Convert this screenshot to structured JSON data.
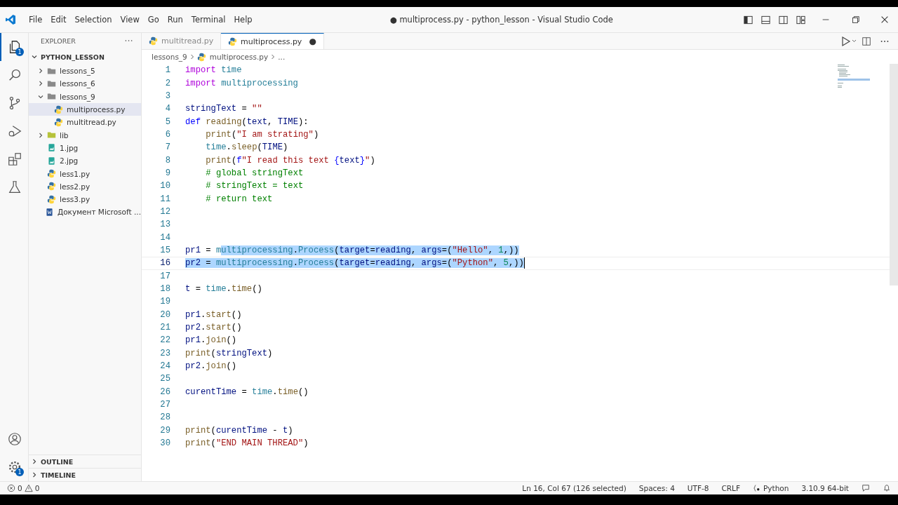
{
  "window": {
    "title": "● multiprocess.py - python_lesson - Visual Studio Code"
  },
  "menu": [
    "File",
    "Edit",
    "Selection",
    "View",
    "Go",
    "Run",
    "Terminal",
    "Help"
  ],
  "activity_bar": [
    {
      "kind": "explorer",
      "selected": true,
      "badge": "1"
    },
    {
      "kind": "search",
      "selected": false
    },
    {
      "kind": "source-control",
      "selected": false
    },
    {
      "kind": "run",
      "selected": false
    },
    {
      "kind": "extensions",
      "selected": false
    },
    {
      "kind": "testing",
      "selected": false
    }
  ],
  "activity_bottom": [
    {
      "kind": "accounts"
    },
    {
      "kind": "settings",
      "badge": "1"
    }
  ],
  "sidebar": {
    "title": "EXPLORER",
    "project": "PYTHON_LESSON",
    "items": [
      {
        "label": "lessons_5",
        "kind": "folder",
        "expanded": false,
        "selected": false
      },
      {
        "label": "lessons_6",
        "kind": "folder",
        "expanded": false,
        "selected": false
      },
      {
        "label": "lessons_9",
        "kind": "folder",
        "expanded": true,
        "selected": false,
        "children": [
          {
            "label": "multiprocess.py",
            "kind": "python",
            "selected": true
          },
          {
            "label": "multitread.py",
            "kind": "python",
            "selected": false
          }
        ]
      },
      {
        "label": "lib",
        "kind": "lib",
        "expanded": false,
        "selected": false
      },
      {
        "label": "1.jpg",
        "kind": "image",
        "selected": false
      },
      {
        "label": "2.jpg",
        "kind": "image",
        "selected": false
      },
      {
        "label": "less1.py",
        "kind": "python",
        "selected": false
      },
      {
        "label": "less2.py",
        "kind": "python",
        "selected": false
      },
      {
        "label": "less3.py",
        "kind": "python",
        "selected": false
      },
      {
        "label": "Документ Microsoft ...",
        "kind": "word",
        "selected": false
      }
    ],
    "sections": [
      "OUTLINE",
      "TIMELINE"
    ]
  },
  "tabs": [
    {
      "label": "multitread.py",
      "selected": false
    },
    {
      "label": "multiprocess.py",
      "selected": true,
      "dirty_mark": "●"
    }
  ],
  "breadcrumb": [
    "lessons_9",
    "multiprocess.py",
    "..."
  ],
  "code": [
    {
      "number": "1",
      "tokens": [
        {
          "text": "import ",
          "kind": "control"
        },
        {
          "text": "time",
          "kind": "type"
        }
      ]
    },
    {
      "number": "2",
      "tokens": [
        {
          "text": "import ",
          "kind": "control"
        },
        {
          "text": "multiprocessing",
          "kind": "type"
        }
      ]
    },
    {
      "number": "3"
    },
    {
      "number": "4",
      "tokens": [
        {
          "text": "stringText",
          "kind": "var"
        },
        {
          "text": " = ",
          "kind": "plain"
        },
        {
          "text": "\"\"",
          "kind": "string"
        }
      ]
    },
    {
      "number": "5",
      "tokens": [
        {
          "text": "def ",
          "kind": "keyword"
        },
        {
          "text": "reading",
          "kind": "function"
        },
        {
          "text": "(",
          "kind": "plain"
        },
        {
          "text": "text",
          "kind": "var"
        },
        {
          "text": ", ",
          "kind": "plain"
        },
        {
          "text": "TIME",
          "kind": "var"
        },
        {
          "text": "):",
          "kind": "plain"
        }
      ]
    },
    {
      "number": "6",
      "indented": true,
      "tokens": [
        {
          "text": "print",
          "kind": "function"
        },
        {
          "text": "(",
          "kind": "plain"
        },
        {
          "text": "\"I am strating\"",
          "kind": "string"
        },
        {
          "text": ")",
          "kind": "plain"
        }
      ]
    },
    {
      "number": "7",
      "indented": true,
      "tokens": [
        {
          "text": "time",
          "kind": "type"
        },
        {
          "text": ".",
          "kind": "plain"
        },
        {
          "text": "sleep",
          "kind": "function"
        },
        {
          "text": "(",
          "kind": "plain"
        },
        {
          "text": "TIME",
          "kind": "var"
        },
        {
          "text": ")",
          "kind": "plain"
        }
      ]
    },
    {
      "number": "8",
      "indented": true,
      "tokens": [
        {
          "text": "print",
          "kind": "function"
        },
        {
          "text": "(",
          "kind": "plain"
        },
        {
          "text": "f",
          "kind": "keyword"
        },
        {
          "text": "\"I read this text ",
          "kind": "string"
        },
        {
          "text": "{",
          "kind": "keyword"
        },
        {
          "text": "text",
          "kind": "var"
        },
        {
          "text": "}",
          "kind": "keyword"
        },
        {
          "text": "\"",
          "kind": "string"
        },
        {
          "text": ")",
          "kind": "plain"
        }
      ]
    },
    {
      "number": "9",
      "indented": true,
      "tokens": [
        {
          "text": "# global stringText",
          "kind": "comment"
        }
      ]
    },
    {
      "number": "10",
      "indented": true,
      "tokens": [
        {
          "text": "# stringText = text",
          "kind": "comment"
        }
      ]
    },
    {
      "number": "11",
      "indented": true,
      "tokens": [
        {
          "text": "# return text",
          "kind": "comment"
        }
      ]
    },
    {
      "number": "12"
    },
    {
      "number": "13"
    },
    {
      "number": "14"
    },
    {
      "number": "15",
      "tokens": [
        {
          "text": "pr1",
          "kind": "var",
          "selected": false
        },
        {
          "text": " = ",
          "kind": "plain",
          "selected": false
        },
        {
          "text": "m",
          "kind": "type",
          "selected": false
        },
        {
          "text": "ultiprocessing",
          "kind": "type",
          "selected": true
        },
        {
          "text": ".",
          "kind": "plain",
          "selected": true
        },
        {
          "text": "Process",
          "kind": "type",
          "selected": true
        },
        {
          "text": "(",
          "kind": "plain",
          "selected": true
        },
        {
          "text": "target",
          "kind": "var",
          "selected": true
        },
        {
          "text": "=",
          "kind": "plain",
          "selected": true
        },
        {
          "text": "reading",
          "kind": "var",
          "selected": true
        },
        {
          "text": ", ",
          "kind": "plain",
          "selected": true
        },
        {
          "text": "args",
          "kind": "var",
          "selected": true
        },
        {
          "text": "=(",
          "kind": "plain",
          "selected": true
        },
        {
          "text": "\"Hello\"",
          "kind": "string",
          "selected": true
        },
        {
          "text": ", ",
          "kind": "plain",
          "selected": true
        },
        {
          "text": "1",
          "kind": "number",
          "selected": true
        },
        {
          "text": ",))",
          "kind": "plain",
          "selected": true
        }
      ]
    },
    {
      "number": "16",
      "current": true,
      "tokens": [
        {
          "text": "pr2",
          "kind": "var",
          "selected": true
        },
        {
          "text": " = ",
          "kind": "plain",
          "selected": true
        },
        {
          "text": "multiprocessing",
          "kind": "type",
          "selected": true
        },
        {
          "text": ".",
          "kind": "plain",
          "selected": true
        },
        {
          "text": "Process",
          "kind": "type",
          "selected": true
        },
        {
          "text": "(",
          "kind": "plain",
          "selected": true
        },
        {
          "text": "target",
          "kind": "var",
          "selected": true
        },
        {
          "text": "=",
          "kind": "plain",
          "selected": true
        },
        {
          "text": "reading",
          "kind": "var",
          "selected": true
        },
        {
          "text": ", ",
          "kind": "plain",
          "selected": true
        },
        {
          "text": "args",
          "kind": "var",
          "selected": true
        },
        {
          "text": "=(",
          "kind": "plain",
          "selected": true
        },
        {
          "text": "\"Python\"",
          "kind": "string",
          "selected": true
        },
        {
          "text": ", ",
          "kind": "plain",
          "selected": true
        },
        {
          "text": "5",
          "kind": "number",
          "selected": true
        },
        {
          "text": ",))",
          "kind": "plain",
          "selected": true
        }
      ]
    },
    {
      "number": "17"
    },
    {
      "number": "18",
      "tokens": [
        {
          "text": "t",
          "kind": "var"
        },
        {
          "text": " = ",
          "kind": "plain"
        },
        {
          "text": "time",
          "kind": "type"
        },
        {
          "text": ".",
          "kind": "plain"
        },
        {
          "text": "time",
          "kind": "function"
        },
        {
          "text": "()",
          "kind": "plain"
        }
      ]
    },
    {
      "number": "19"
    },
    {
      "number": "20",
      "tokens": [
        {
          "text": "pr1",
          "kind": "var"
        },
        {
          "text": ".",
          "kind": "plain"
        },
        {
          "text": "start",
          "kind": "function"
        },
        {
          "text": "()",
          "kind": "plain"
        }
      ]
    },
    {
      "number": "21",
      "tokens": [
        {
          "text": "pr2",
          "kind": "var"
        },
        {
          "text": ".",
          "kind": "plain"
        },
        {
          "text": "start",
          "kind": "function"
        },
        {
          "text": "()",
          "kind": "plain"
        }
      ]
    },
    {
      "number": "22",
      "tokens": [
        {
          "text": "pr1",
          "kind": "var"
        },
        {
          "text": ".",
          "kind": "plain"
        },
        {
          "text": "join",
          "kind": "function"
        },
        {
          "text": "()",
          "kind": "plain"
        }
      ]
    },
    {
      "number": "23",
      "tokens": [
        {
          "text": "print",
          "kind": "function"
        },
        {
          "text": "(",
          "kind": "plain"
        },
        {
          "text": "stringText",
          "kind": "var"
        },
        {
          "text": ")",
          "kind": "plain"
        }
      ]
    },
    {
      "number": "24",
      "tokens": [
        {
          "text": "pr2",
          "kind": "var"
        },
        {
          "text": ".",
          "kind": "plain"
        },
        {
          "text": "join",
          "kind": "function"
        },
        {
          "text": "()",
          "kind": "plain"
        }
      ]
    },
    {
      "number": "25"
    },
    {
      "number": "26",
      "tokens": [
        {
          "text": "curentTime",
          "kind": "var"
        },
        {
          "text": " = ",
          "kind": "plain"
        },
        {
          "text": "time",
          "kind": "type"
        },
        {
          "text": ".",
          "kind": "plain"
        },
        {
          "text": "time",
          "kind": "function"
        },
        {
          "text": "()",
          "kind": "plain"
        }
      ]
    },
    {
      "number": "27"
    },
    {
      "number": "28"
    },
    {
      "number": "29",
      "tokens": [
        {
          "text": "print",
          "kind": "function"
        },
        {
          "text": "(",
          "kind": "plain"
        },
        {
          "text": "curentTime",
          "kind": "var"
        },
        {
          "text": " - ",
          "kind": "plain"
        },
        {
          "text": "t",
          "kind": "var"
        },
        {
          "text": ")",
          "kind": "plain"
        }
      ]
    },
    {
      "number": "30",
      "tokens": [
        {
          "text": "print",
          "kind": "function"
        },
        {
          "text": "(",
          "kind": "plain"
        },
        {
          "text": "\"END MAIN THREAD\"",
          "kind": "string"
        },
        {
          "text": ")",
          "kind": "plain"
        }
      ]
    }
  ],
  "status_bar": {
    "errors": "0",
    "warnings": "0",
    "right": [
      {
        "text": "Ln 16, Col 67 (126 selected)",
        "kind": "plain"
      },
      {
        "text": "Spaces: 4",
        "kind": "plain"
      },
      {
        "text": "UTF-8",
        "kind": "plain"
      },
      {
        "text": "CRLF",
        "kind": "plain"
      },
      {
        "text": "Python",
        "kind": "language"
      },
      {
        "text": "3.10.9 64-bit",
        "kind": "plain"
      }
    ]
  }
}
